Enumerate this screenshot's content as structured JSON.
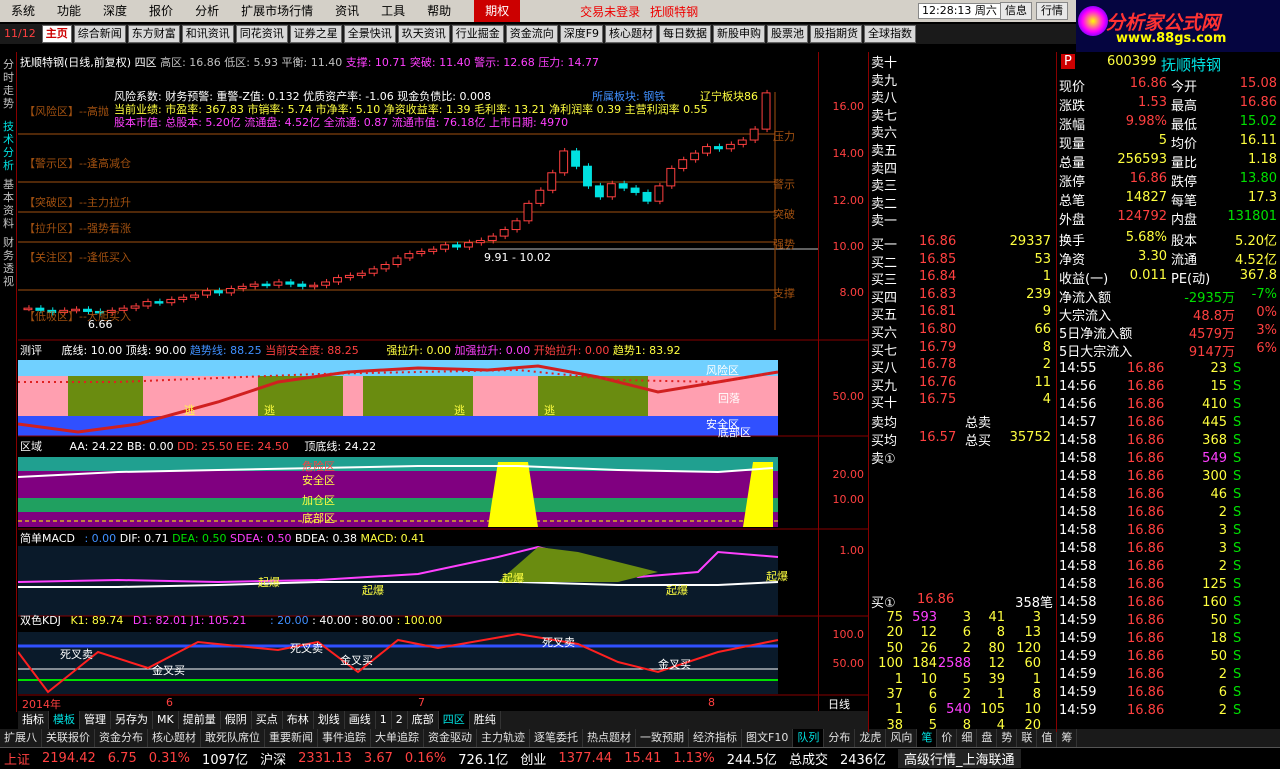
{
  "menu": {
    "items": [
      "系统",
      "功能",
      "深度",
      "报价",
      "分析",
      "扩展市场行情",
      "资讯",
      "工具",
      "帮助"
    ],
    "active": "期权",
    "msg1": "交易未登录",
    "msg2": "抚顺特钢",
    "clock": "12:28:13 周六",
    "right_buttons": [
      "信息",
      "行情"
    ]
  },
  "logo": {
    "line1": "分析家公式网",
    "line2": "www.88gs.com"
  },
  "toolbar": {
    "indicator": "11/12",
    "items": [
      "主页",
      "综合新闻",
      "东方财富",
      "和讯资讯",
      "同花资讯",
      "证券之星",
      "全景快讯",
      "玖天资讯",
      "行业掘金",
      "资金流向",
      "深度F9",
      "核心题材",
      "每日数据",
      "新股申购",
      "股票池",
      "股指期货",
      "全球指数"
    ]
  },
  "lefttabs": [
    "分时走势",
    "技术分析",
    "基本资料",
    "财务透视"
  ],
  "chart": {
    "header": {
      "name": "抚顺特钢(日线,前复权)",
      "section": "四区",
      "high": "高区: 16.86",
      "low": "低区: 5.93",
      "flat": "平衡: 11.40",
      "support": "支撑: 10.71",
      "breakout": "突破: 11.40",
      "warn": "警示: 12.68",
      "pressure": "压力: 14.77"
    },
    "info1": "风险系数: 财务预警: 重警-Z值: 0.132 优质资产率: -1.06 现金负债比: 0.008",
    "info2": "当前业绩: 市盈率: 367.83 市销率: 5.74 市净率: 5.10 净资收益率: 1.39 毛利率: 13.21 净利润率 0.39 主营利润率 0.55",
    "info3": "股本市值: 总股本: 5.20亿 流通盘: 4.52亿 全流通: 0.87 流通市值: 76.18亿 上市日期: 4970",
    "sector": "所属板块: 钢铁",
    "lead": "辽宁板块86",
    "zones": [
      "【风险区】--高抛",
      "【警示区】--逢高减仓",
      "【突破区】--主力拉升",
      "【拉升区】--强势看涨",
      "【关注区】--逢低买入",
      "【低吸区】--大胆买入"
    ],
    "zone_right": [
      "压力",
      "警示",
      "突破",
      "强势",
      "支撑"
    ],
    "range_label": "9.91 - 10.02",
    "low_label": "6.66",
    "yticks": [
      "16.00",
      "14.00",
      "12.00",
      "10.00",
      "8.00"
    ],
    "p2": {
      "title": "测评",
      "items": [
        "底线: 10.00",
        "顶线: 90.00",
        "趋势线: 88.25",
        "当前安全度: 88.25",
        "强拉升: 0.00",
        "加强拉升: 0.00",
        "开始拉升: 0.00",
        "趋势1: 83.92"
      ],
      "ytick": "50.00",
      "labels": [
        "风险区",
        "逃",
        "逃",
        "逃",
        "逃",
        "安全区",
        "底部区",
        "回落"
      ]
    },
    "p3": {
      "title": "区域",
      "items": [
        "AA: 24.22",
        "BB: 0.00",
        "DD: 25.50",
        "EE: 24.50",
        "顶底线: 24.22"
      ],
      "yticks": [
        "20.00",
        "10.00"
      ],
      "labels": [
        "危险区",
        "安全区",
        "加仓区",
        "底部区"
      ]
    },
    "p4": {
      "title": "简单MACD",
      "items": [
        ": 0.00",
        "DIF: 0.71",
        "DEA: 0.50",
        "SDEA: 0.50",
        "BDEA: 0.38",
        "MACD: 0.41"
      ],
      "ytick": "1.00",
      "labels": [
        "起爆",
        "起爆",
        "起爆",
        "起爆",
        "起爆"
      ]
    },
    "p5": {
      "title": "双色KDJ",
      "items": [
        "K1: 89.74",
        "D1: 82.01",
        "J1: 105.21",
        ": 20.00",
        ": 40.00",
        ": 80.00",
        ": 100.00"
      ],
      "yticks": [
        "100.0",
        "50.00"
      ],
      "labels": [
        "死叉卖",
        "金叉买",
        "死叉卖",
        "金叉买",
        "死叉卖",
        "金叉买"
      ]
    },
    "xaxis": {
      "year": "2014年",
      "m1": "6",
      "m2": "7",
      "m3": "8"
    },
    "period": "日线"
  },
  "bottomtabs": [
    "指标",
    "模板",
    "管理",
    "另存为",
    "MK",
    "提前量",
    "假阴",
    "买点",
    "布林",
    "划线",
    "画线",
    "1",
    "2",
    "底部",
    "四区",
    "胜纯"
  ],
  "bottomtabs_sel": "四区",
  "bottomtabs2": [
    "扩展八",
    "关联报价",
    "资金分布",
    "核心题材",
    "敢死队席位",
    "重要新闻",
    "事件追踪",
    "大单追踪",
    "资金驱动",
    "主力轨迹",
    "逐笔委托",
    "热点题材",
    "一致预期",
    "经济指标",
    "图文F10",
    "队列",
    "分布",
    "龙虎",
    "风向",
    "笔",
    "价",
    "细",
    "盘",
    "势",
    "联",
    "值",
    "筹"
  ],
  "order_book": {
    "sells": [
      "卖十",
      "卖九",
      "卖八",
      "卖七",
      "卖六",
      "卖五",
      "卖四",
      "卖三",
      "卖二",
      "卖一"
    ],
    "buys": [
      [
        "买一",
        "16.86",
        "29337"
      ],
      [
        "买二",
        "16.85",
        "53"
      ],
      [
        "买三",
        "16.84",
        "1"
      ],
      [
        "买四",
        "16.83",
        "239"
      ],
      [
        "买五",
        "16.81",
        "9"
      ],
      [
        "买六",
        "16.80",
        "66"
      ],
      [
        "买七",
        "16.79",
        "8"
      ],
      [
        "买八",
        "16.78",
        "2"
      ],
      [
        "买九",
        "16.76",
        "11"
      ],
      [
        "买十",
        "16.75",
        "4"
      ]
    ],
    "avg_sell_label": "卖均",
    "total_sell_label": "总卖",
    "avg_buy_label": "买均",
    "avg_buy": "16.57",
    "total_buy_label": "总买",
    "total_buy": "35752",
    "sell1_label": "卖①",
    "buy1_label": "买①",
    "buy1_price": "16.86",
    "buy1_count": "358笔",
    "queue": [
      [
        "75",
        "593",
        "3",
        "41",
        "3"
      ],
      [
        "20",
        "12",
        "6",
        "8",
        "13"
      ],
      [
        "50",
        "26",
        "2",
        "80",
        "120"
      ],
      [
        "100",
        "184",
        "2588",
        "12",
        "60"
      ],
      [
        "1",
        "10",
        "5",
        "39",
        "1"
      ],
      [
        "37",
        "6",
        "2",
        "1",
        "8"
      ],
      [
        "1",
        "6",
        "540",
        "105",
        "10"
      ],
      [
        "38",
        "5",
        "8",
        "4",
        "20"
      ]
    ]
  },
  "quote": {
    "code": "600399",
    "name": "抚顺特钢",
    "badge": "P",
    "rows": [
      [
        "现价",
        "16.86",
        "今开",
        "15.08"
      ],
      [
        "涨跌",
        "1.53",
        "最高",
        "16.86"
      ],
      [
        "涨幅",
        "9.98%",
        "最低",
        "15.02"
      ],
      [
        "现量",
        "5",
        "均价",
        "16.11"
      ],
      [
        "总量",
        "256593",
        "量比",
        "1.18"
      ],
      [
        "涨停",
        "16.86",
        "跌停",
        "13.80"
      ],
      [
        "总笔",
        "14827",
        "每笔",
        "17.3"
      ],
      [
        "外盘",
        "124792",
        "内盘",
        "131801"
      ]
    ],
    "rows2": [
      [
        "换手",
        "5.68%",
        "股本",
        "5.20亿"
      ],
      [
        "净资",
        "3.30",
        "流通",
        "4.52亿"
      ],
      [
        "收益(一)",
        "0.011",
        "PE(动)",
        "367.8"
      ]
    ],
    "flows": [
      [
        "净流入额",
        "-2935万",
        "-7%"
      ],
      [
        "大宗流入",
        "48.8万",
        "0%"
      ],
      [
        "5日净流入额",
        "4579万",
        "3%"
      ],
      [
        "5日大宗流入",
        "9147万",
        "6%"
      ]
    ],
    "ticks": [
      [
        "14:55",
        "16.86",
        "23",
        "S"
      ],
      [
        "14:56",
        "16.86",
        "15",
        "S"
      ],
      [
        "14:56",
        "16.86",
        "410",
        "S"
      ],
      [
        "14:57",
        "16.86",
        "445",
        "S"
      ],
      [
        "14:58",
        "16.86",
        "368",
        "S"
      ],
      [
        "14:58",
        "16.86",
        "549",
        "S"
      ],
      [
        "14:58",
        "16.86",
        "300",
        "S"
      ],
      [
        "14:58",
        "16.86",
        "46",
        "S"
      ],
      [
        "14:58",
        "16.86",
        "2",
        "S"
      ],
      [
        "14:58",
        "16.86",
        "3",
        "S"
      ],
      [
        "14:58",
        "16.86",
        "3",
        "S"
      ],
      [
        "14:58",
        "16.86",
        "2",
        "S"
      ],
      [
        "14:58",
        "16.86",
        "125",
        "S"
      ],
      [
        "14:58",
        "16.86",
        "160",
        "S"
      ],
      [
        "14:59",
        "16.86",
        "50",
        "S"
      ],
      [
        "14:59",
        "16.86",
        "18",
        "S"
      ],
      [
        "14:59",
        "16.86",
        "50",
        "S"
      ],
      [
        "14:59",
        "16.86",
        "2",
        "S"
      ],
      [
        "14:59",
        "16.86",
        "6",
        "S"
      ],
      [
        "14:59",
        "16.86",
        "2",
        "S"
      ]
    ]
  },
  "status": {
    "sh_label": "上证",
    "sh": "2194.42",
    "sh_chg": "6.75",
    "sh_pct": "0.31%",
    "sh_amt": "1097亿",
    "hs_label": "沪深",
    "hs": "2331.13",
    "hs_chg": "3.67",
    "hs_pct": "0.16%",
    "hs_amt": "726.1亿",
    "cy_label": "创业",
    "cy": "1377.44",
    "cy_chg": "15.41",
    "cy_pct": "1.13%",
    "cy_amt": "244.5亿",
    "total_label": "总成交",
    "total": "2436亿",
    "conn": "高级行情_上海联通"
  }
}
